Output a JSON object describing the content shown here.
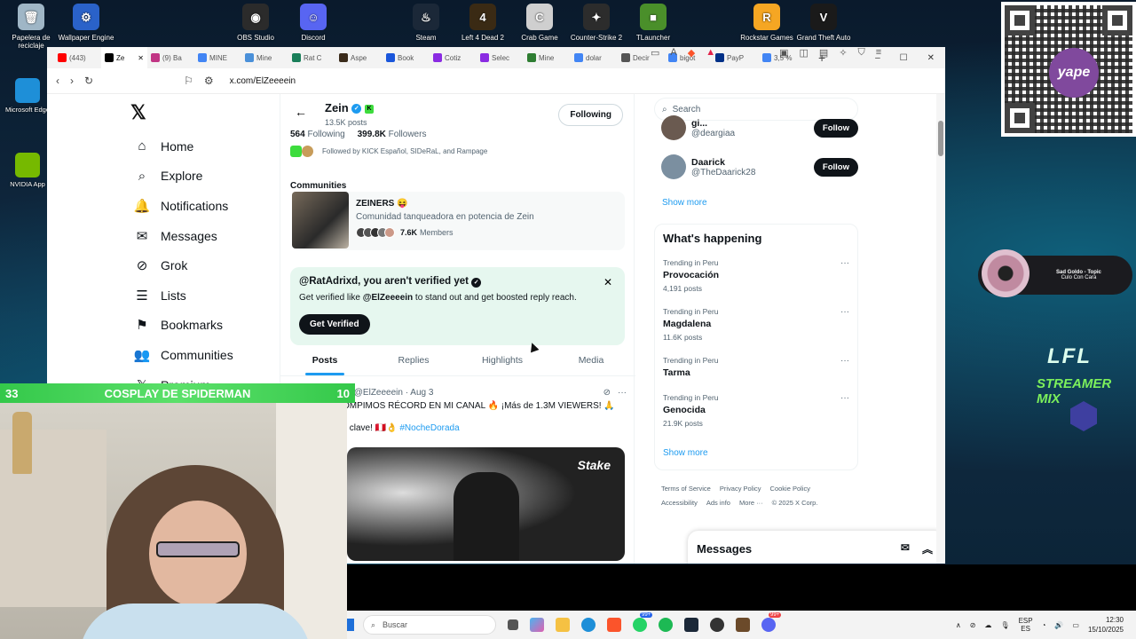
{
  "desktop": {
    "icons": [
      {
        "label": "Papelera de reciclaje",
        "color": "#9fb6c6",
        "glyph": "🗑"
      },
      {
        "label": "Wallpaper Engine",
        "color": "#2a62c9",
        "glyph": "⚙"
      },
      {
        "label": "OBS Studio",
        "color": "#2b2b2b",
        "glyph": "◉"
      },
      {
        "label": "Discord",
        "color": "#5865f2",
        "glyph": "☺"
      },
      {
        "label": "Steam",
        "color": "#1b2838",
        "glyph": "♨"
      },
      {
        "label": "Left 4 Dead 2",
        "color": "#3a2a14",
        "glyph": "4"
      },
      {
        "label": "Crab Game",
        "color": "#cfcfcf",
        "glyph": "C"
      },
      {
        "label": "Counter-Strike 2",
        "color": "#2c2c2c",
        "glyph": "✦"
      },
      {
        "label": "TLauncher",
        "color": "#4a8f2a",
        "glyph": "■"
      },
      {
        "label": "Rockstar Games",
        "color": "#f5a623",
        "glyph": "R"
      },
      {
        "label": "Grand Theft Auto",
        "color": "#1a1a1a",
        "glyph": "V"
      }
    ],
    "left_icons": [
      {
        "label": "Microsoft Edge",
        "color": "#1e8fd8"
      },
      {
        "label": "NVIDIA App",
        "color": "#76b900"
      }
    ],
    "qr_label": "yape",
    "music": {
      "title": "Sad Goldo - Topic",
      "subtitle": "Culo Con Cara"
    },
    "overlay_lfl": "LFL",
    "overlay_mix": "STREAMER MIX"
  },
  "browser": {
    "tabs": [
      {
        "label": "(443)",
        "color": "#ff0000"
      },
      {
        "label": "Ze",
        "color": "#000000",
        "active": true
      },
      {
        "label": "(9) Ba",
        "color": "#c13584"
      },
      {
        "label": "MINE",
        "color": "#4285f4"
      },
      {
        "label": "Mine",
        "color": "#4a90d9"
      },
      {
        "label": "Rat C",
        "color": "#1a7f5a"
      },
      {
        "label": "Aspe",
        "color": "#3b2b1b"
      },
      {
        "label": "Book",
        "color": "#1a56db"
      },
      {
        "label": "Cotiz",
        "color": "#8a2be2"
      },
      {
        "label": "Selec",
        "color": "#8a2be2"
      },
      {
        "label": "Mine",
        "color": "#2e7d32"
      },
      {
        "label": "dolar",
        "color": "#4285f4"
      },
      {
        "label": "Decir",
        "color": "#555555"
      },
      {
        "label": "bigot",
        "color": "#4285f4"
      },
      {
        "label": "PayP",
        "color": "#003087"
      },
      {
        "label": "3,5 %",
        "color": "#4285f4"
      }
    ],
    "new_tab": "+",
    "url": "x.com/ElZeeeein"
  },
  "nav": {
    "logo": "𝕏",
    "items": [
      {
        "label": "Home",
        "icon": "⌂"
      },
      {
        "label": "Explore",
        "icon": "⌕"
      },
      {
        "label": "Notifications",
        "icon": "🔔"
      },
      {
        "label": "Messages",
        "icon": "✉"
      },
      {
        "label": "Grok",
        "icon": "⊘"
      },
      {
        "label": "Lists",
        "icon": "☰"
      },
      {
        "label": "Bookmarks",
        "icon": "⚑"
      },
      {
        "label": "Communities",
        "icon": "👥"
      },
      {
        "label": "Premium",
        "icon": "𝕏"
      }
    ]
  },
  "profile": {
    "name": "Zein",
    "posts_count": "13.5K posts",
    "following_btn": "Following",
    "following_count": "564",
    "following_label": "Following",
    "followers_count": "399.8K",
    "followers_label": "Followers",
    "followed_by": "Followed by KICK Español, SIDeRaL, and Rampage"
  },
  "communities": {
    "heading": "Communities",
    "name": "ZEINERS 😝",
    "desc": "Comunidad tanqueadora en potencia de Zein",
    "members_count": "7.6K",
    "members_label": "Members"
  },
  "verify_banner": {
    "title": "@RatAdrixd, you aren't verified yet",
    "desc_pre": "Get verified like ",
    "desc_handle": "@ElZeeeein",
    "desc_post": " to stand out and get boosted reply reach.",
    "button": "Get Verified",
    "close": "✕"
  },
  "profile_tabs": [
    "Posts",
    "Replies",
    "Highlights",
    "Media"
  ],
  "post": {
    "handle": "@ElZeeeein · Aug 3",
    "line1": "OMPIMOS RÉCORD EN MI CANAL 🔥 ¡Más de 1.3M VIEWERS! 🙏",
    "line2_pre": "s clave! 🇵🇪👌 ",
    "hashtag": "#NocheDorada",
    "media_brand": "Stake"
  },
  "sidebar": {
    "search_placeholder": "Search",
    "who_to_follow": [
      {
        "name": "gi...",
        "handle": "@deargiaa",
        "button": "Follow"
      },
      {
        "name": "Daarick",
        "handle": "@TheDaarick28",
        "button": "Follow"
      }
    ],
    "show_more": "Show more",
    "happening_title": "What's happening",
    "trends": [
      {
        "context": "Trending in Peru",
        "name": "Provocación",
        "posts": "4,191 posts"
      },
      {
        "context": "Trending in Peru",
        "name": "Magdalena",
        "posts": "11.6K posts"
      },
      {
        "context": "Trending in Peru",
        "name": "Tarma",
        "posts": ""
      },
      {
        "context": "Trending in Peru",
        "name": "Genocida",
        "posts": "21.9K posts"
      }
    ],
    "show_more2": "Show more",
    "footer": [
      "Terms of Service",
      "Privacy Policy",
      "Cookie Policy",
      "Accessibility",
      "Ads info",
      "More ···",
      "© 2025 X Corp."
    ]
  },
  "messages_bar": {
    "title": "Messages"
  },
  "stream_overlay": {
    "left_num": "33",
    "title": "COSPLAY DE SPIDERMAN",
    "right_num": "10"
  },
  "taskbar": {
    "search": "Buscar",
    "lang1": "ESP",
    "lang2": "ES",
    "time": "12:30",
    "date": "15/10/2025",
    "badge1": "99+",
    "badge2": "99+"
  }
}
